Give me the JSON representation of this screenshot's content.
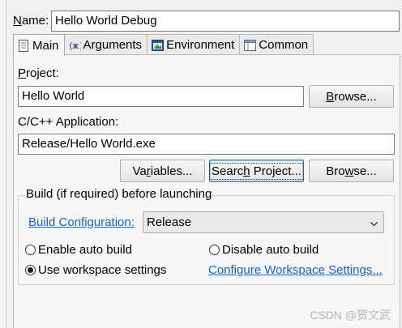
{
  "name": {
    "label_u": "N",
    "label_rest": "ame:",
    "value": "Hello World Debug"
  },
  "tabs": [
    {
      "label": "Main",
      "icon": "main-tab-icon"
    },
    {
      "label": "Arguments",
      "icon": "arguments-icon"
    },
    {
      "label": "Environment",
      "icon": "environment-icon"
    },
    {
      "label": "Common",
      "icon": "common-icon"
    }
  ],
  "project": {
    "label_u": "P",
    "label_rest": "roject:",
    "value": "Hello World",
    "browse_u": "B",
    "browse_rest": "rowse..."
  },
  "application": {
    "label": "C/C++ Application:",
    "value": "Release/Hello World.exe",
    "variables_pre": "Va",
    "variables_u": "r",
    "variables_post": "iables...",
    "search_pre": "Searc",
    "search_u": "h",
    "search_post": " Project...",
    "browse_pre": "Bro",
    "browse_u": "w",
    "browse_post": "se..."
  },
  "build": {
    "group_title": "Build (if required) before launching",
    "config_label": "Build Configuration:",
    "config_value": "Release",
    "enable_auto": "Enable auto build",
    "disable_auto": "Disable auto build",
    "use_workspace": "Use workspace settings",
    "configure_link": "Configure Workspace Settings...",
    "selected": "use_workspace"
  },
  "watermark": "CSDN @贺文武"
}
